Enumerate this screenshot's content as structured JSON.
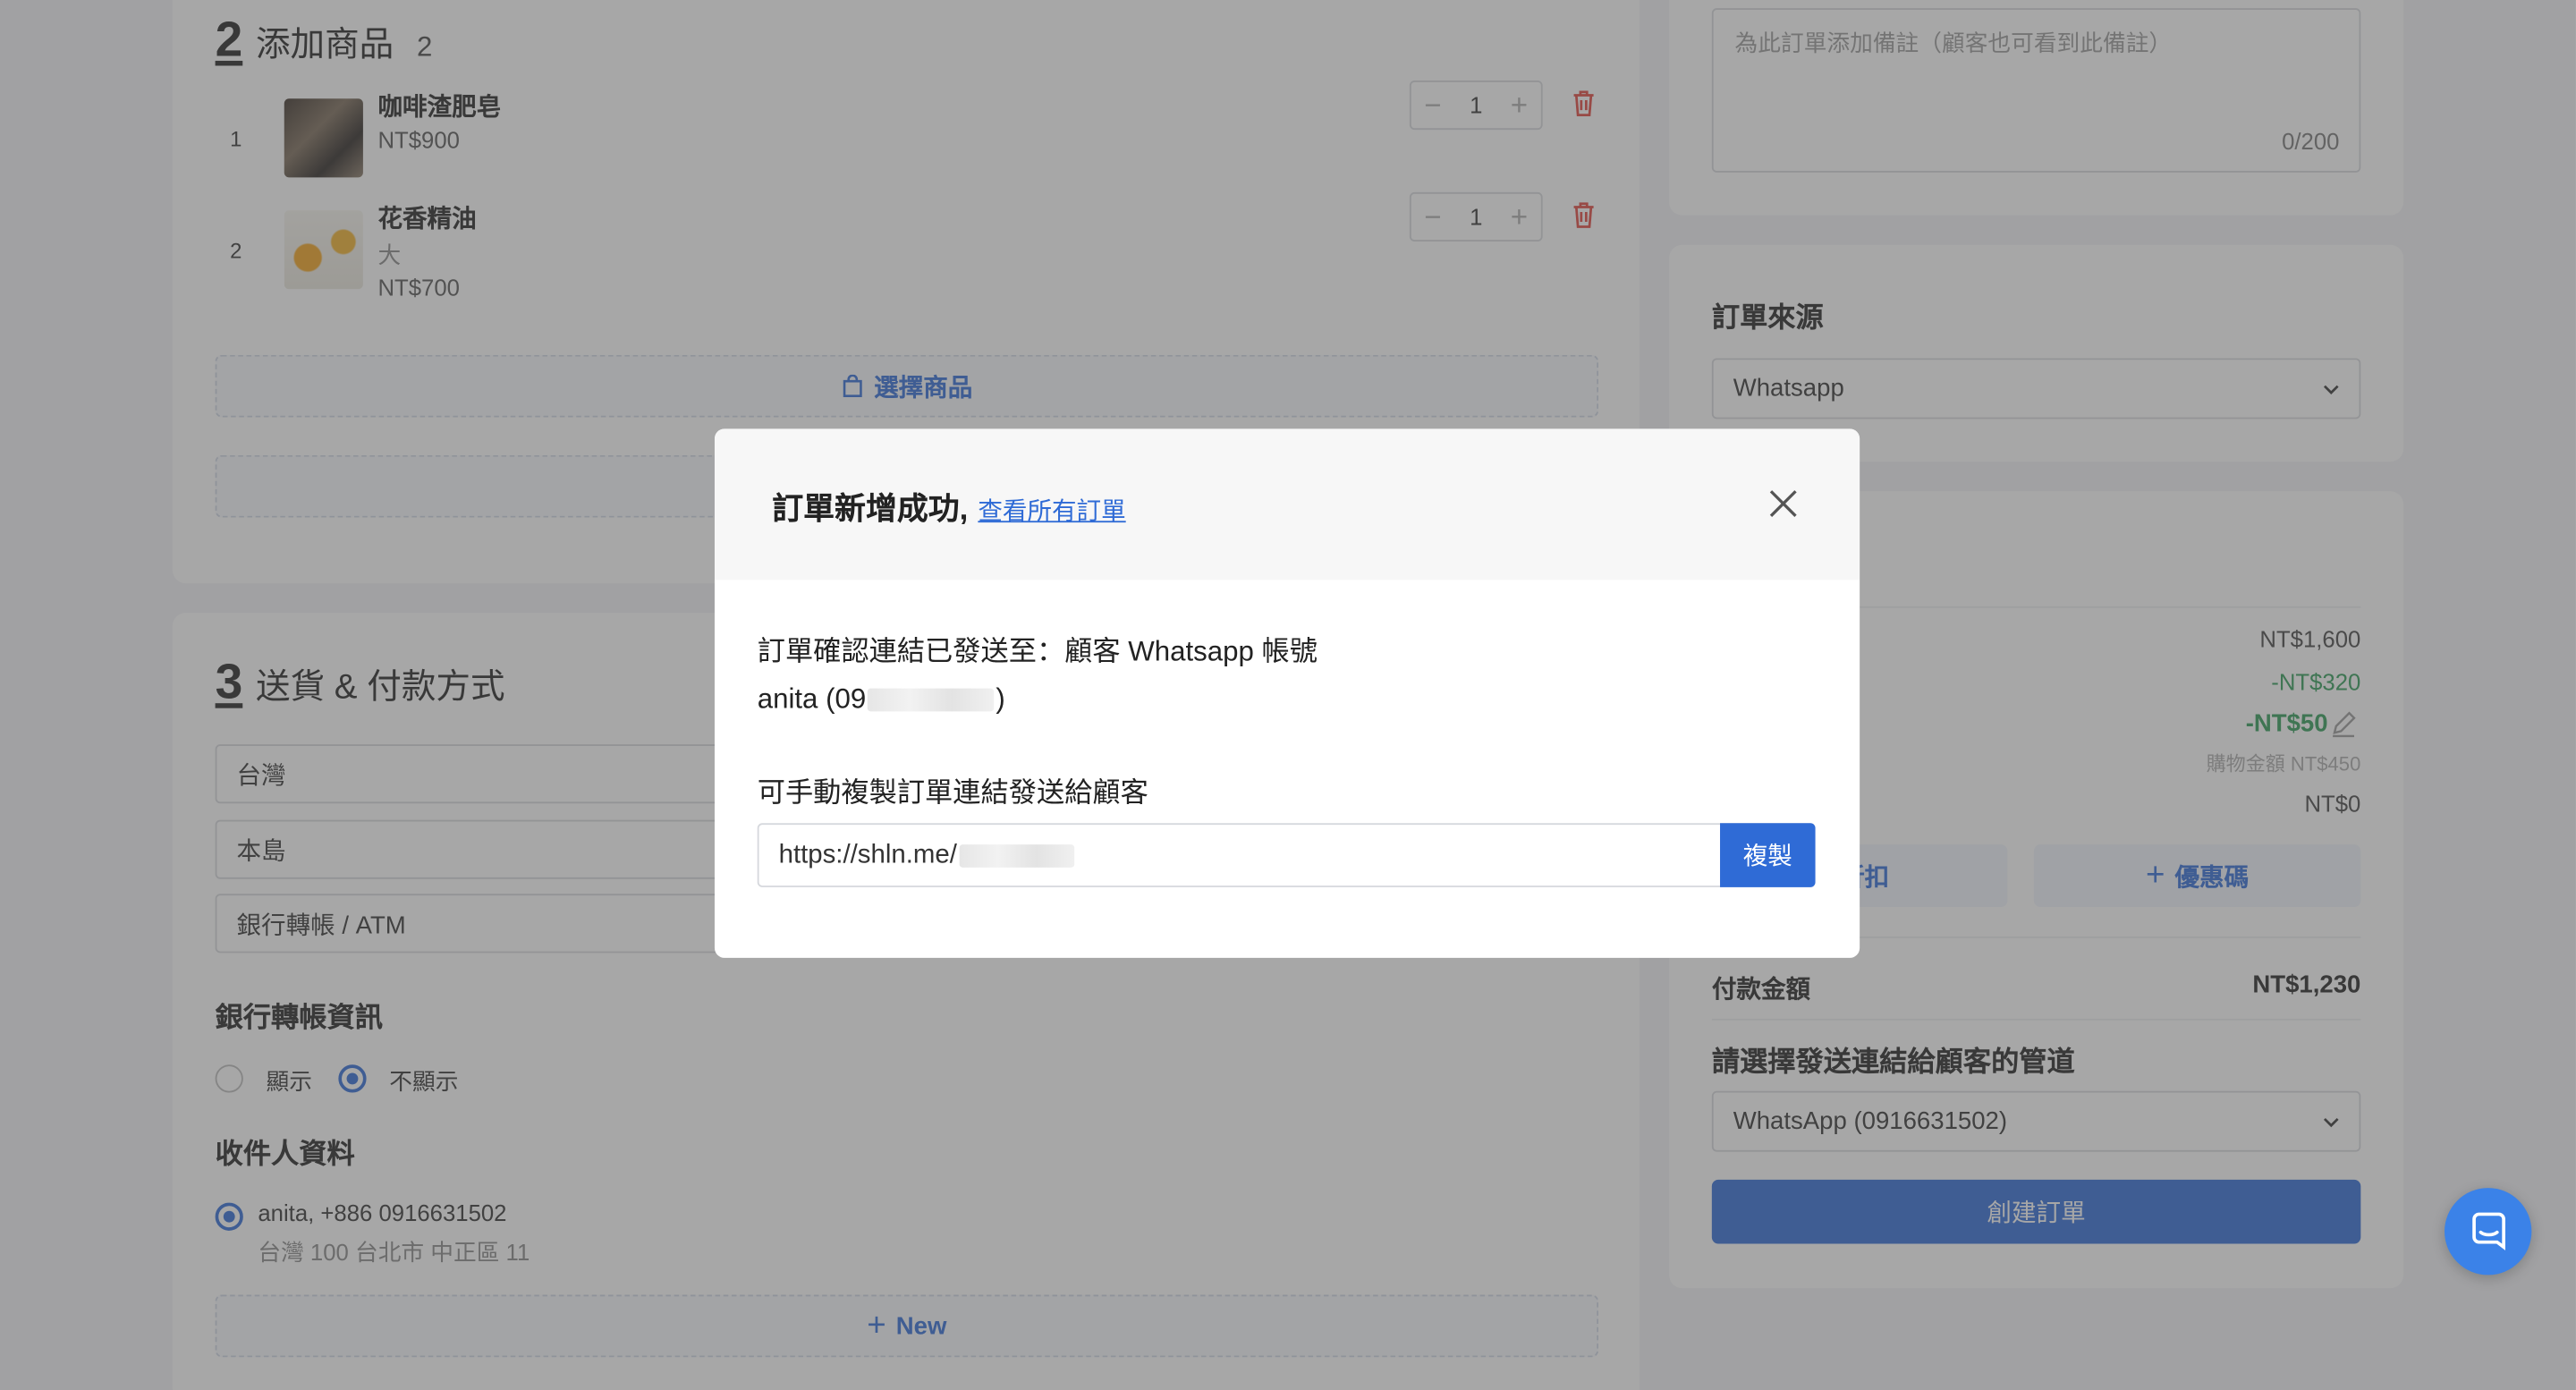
{
  "products_section": {
    "step_number": "2",
    "title": "添加商品",
    "count": "2",
    "items": [
      {
        "index": "1",
        "name": "咖啡渣肥皂",
        "variant": "",
        "price": "NT$900",
        "quantity": "1"
      },
      {
        "index": "2",
        "name": "花香精油",
        "variant": "大",
        "price": "NT$700",
        "quantity": "1"
      }
    ],
    "select_products_label": "選擇商品"
  },
  "shipping_section": {
    "step_number": "3",
    "title": "送貨 & 付款方式",
    "country": "台灣",
    "region": "本島",
    "payment_method": "銀行轉帳 / ATM",
    "bank_info_title": "銀行轉帳資訊",
    "bank_info_options": [
      "顯示",
      "不顯示"
    ],
    "bank_info_selected": "不顯示",
    "recipient_title": "收件人資料",
    "recipient": {
      "name_phone": "anita, +886 0916631502",
      "address": "台灣 100 台北市 中正區 11"
    },
    "new_button_label": "New"
  },
  "note": {
    "placeholder": "為此訂單添加備註（顧客也可看到此備註）",
    "counter": "0/200"
  },
  "order_source": {
    "title": "訂單來源",
    "selected": "Whatsapp"
  },
  "summary": {
    "lines": [
      "NT$1,600",
      "-NT$320",
      "-NT$50",
      "購物金額 NT$450",
      "NT$0"
    ],
    "partial_bracket": ")",
    "discount_button_label": "入折扣",
    "coupon_button_label": "優惠碼",
    "payment_label": "付款金額",
    "payment_amount": "NT$1,230",
    "channel_title": "請選擇發送連結給顧客的管道",
    "channel_selected": "WhatsApp (0916631502)",
    "create_order_label": "創建訂單"
  },
  "modal": {
    "title": "訂單新增成功,",
    "view_all_link": "查看所有訂單",
    "sent_to_text": "訂單確認連結已發送至：顧客 Whatsapp 帳號",
    "recipient_prefix": "anita (09",
    "recipient_suffix": ")",
    "manual_copy_text": "可手動複製訂單連結發送給顧客",
    "url_prefix": "https://shln.me/",
    "copy_button_label": "複製"
  },
  "colors": {
    "primary": "#2f6bd6",
    "discount_green": "#2e9b57",
    "delete_red": "#e0453c",
    "overlay": "rgba(80,80,80,0.5)"
  }
}
